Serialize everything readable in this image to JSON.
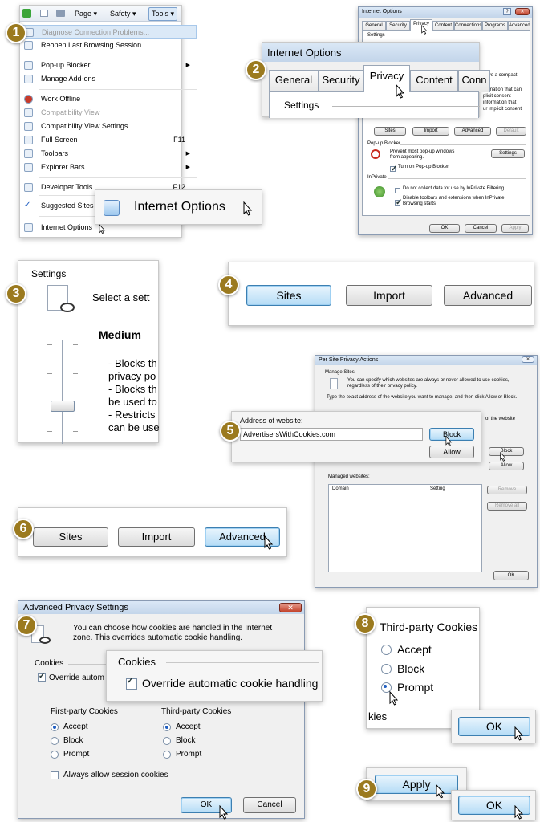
{
  "toolbar": {
    "page": "Page ▾",
    "safety": "Safety ▾",
    "tools": "Tools ▾"
  },
  "tools_menu": {
    "items": [
      {
        "label": "Diagnose Connection Problems...",
        "disabled": true
      },
      {
        "label": "Reopen Last Browsing Session"
      },
      {
        "label": "Pop-up Blocker",
        "submenu": true
      },
      {
        "label": "Manage Add-ons"
      },
      {
        "label": "Work Offline"
      },
      {
        "label": "Compatibility View",
        "disabled": true
      },
      {
        "label": "Compatibility View Settings"
      },
      {
        "label": "Full Screen",
        "shortcut": "F11"
      },
      {
        "label": "Toolbars",
        "submenu": true
      },
      {
        "label": "Explorer Bars",
        "submenu": true
      },
      {
        "label": "Developer Tools",
        "shortcut": "F12"
      },
      {
        "label": "Suggested Sites"
      },
      {
        "label": "Internet Options"
      }
    ]
  },
  "steps": [
    "1",
    "2",
    "3",
    "4",
    "5",
    "6",
    "7",
    "8",
    "9"
  ],
  "callout1": {
    "label": "Internet Options"
  },
  "io_dialog": {
    "title": "Internet Options",
    "tabs": [
      "General",
      "Security",
      "Privacy",
      "Content",
      "Connections",
      "Programs",
      "Advanced"
    ],
    "settings_label": "Settings",
    "text1": "have a compact",
    "text2": "formation that can",
    "text3": "plicit consent",
    "text4": "information that",
    "text5": "ur implicit consent",
    "buttons": [
      "Sites",
      "Import",
      "Advanced",
      "Default"
    ],
    "popup_label": "Pop-up Blocker",
    "popup_text": "Prevent most pop-up windows from appearing.",
    "popup_settings": "Settings",
    "popup_check": "Turn on Pop-up Blocker",
    "inprivate_label": "InPrivate",
    "inprivate_check1": "Do not collect data for use by InPrivate Filtering",
    "inprivate_check2": "Disable toolbars and extensions when InPrivate Browsing starts",
    "ok": "OK",
    "cancel": "Cancel",
    "apply": "Apply"
  },
  "callout2": {
    "title": "Internet Options",
    "tabs": [
      "General",
      "Security",
      "Privacy",
      "Content",
      "Conn"
    ],
    "settings": "Settings"
  },
  "callout3": {
    "settings": "Settings",
    "select": "Select a sett",
    "level": "Medium",
    "lines": [
      "- Blocks th",
      "privacy po",
      "- Blocks th",
      "be used to",
      "- Restricts",
      "can be use"
    ]
  },
  "callout4": {
    "buttons": [
      "Sites",
      "Import",
      "Advanced"
    ]
  },
  "per_site": {
    "title": "Per Site Privacy Actions",
    "manage": "Manage Sites",
    "desc": "You can specify which websites are always or never allowed to use cookies, regardless of their privacy policy.",
    "type_text": "Type the exact address of the website you want to manage, and then click Allow or Block.",
    "of_website": "of the website",
    "block": "Block",
    "allow": "Allow",
    "managed": "Managed websites:",
    "col_domain": "Domain",
    "col_setting": "Setting",
    "remove": "Remove",
    "remove_all": "Remove all",
    "ok": "OK"
  },
  "callout5": {
    "label": "Address of website:",
    "value": "AdvertisersWithCookies.com",
    "block": "Block",
    "allow": "Allow"
  },
  "callout6": {
    "buttons": [
      "Sites",
      "Import",
      "Advanced"
    ]
  },
  "adv_privacy": {
    "title": "Advanced Privacy Settings",
    "desc": "You can choose how cookies are handled in the Internet zone.  This overrides automatic cookie handling.",
    "cookies": "Cookies",
    "override": "Override autom",
    "first": "First-party Cookies",
    "third": "Third-party Cookies",
    "accept": "Accept",
    "block": "Block",
    "prompt": "Prompt",
    "session": "Always allow session cookies",
    "ok": "OK",
    "cancel": "Cancel"
  },
  "callout7": {
    "cookies": "Cookies",
    "override": "Override automatic cookie handling"
  },
  "callout8": {
    "title": "Third-party Cookies",
    "accept": "Accept",
    "block": "Block",
    "prompt": "Prompt",
    "kies": "kies",
    "ok": "OK"
  },
  "callout9": {
    "apply": "Apply",
    "ok": "OK"
  }
}
